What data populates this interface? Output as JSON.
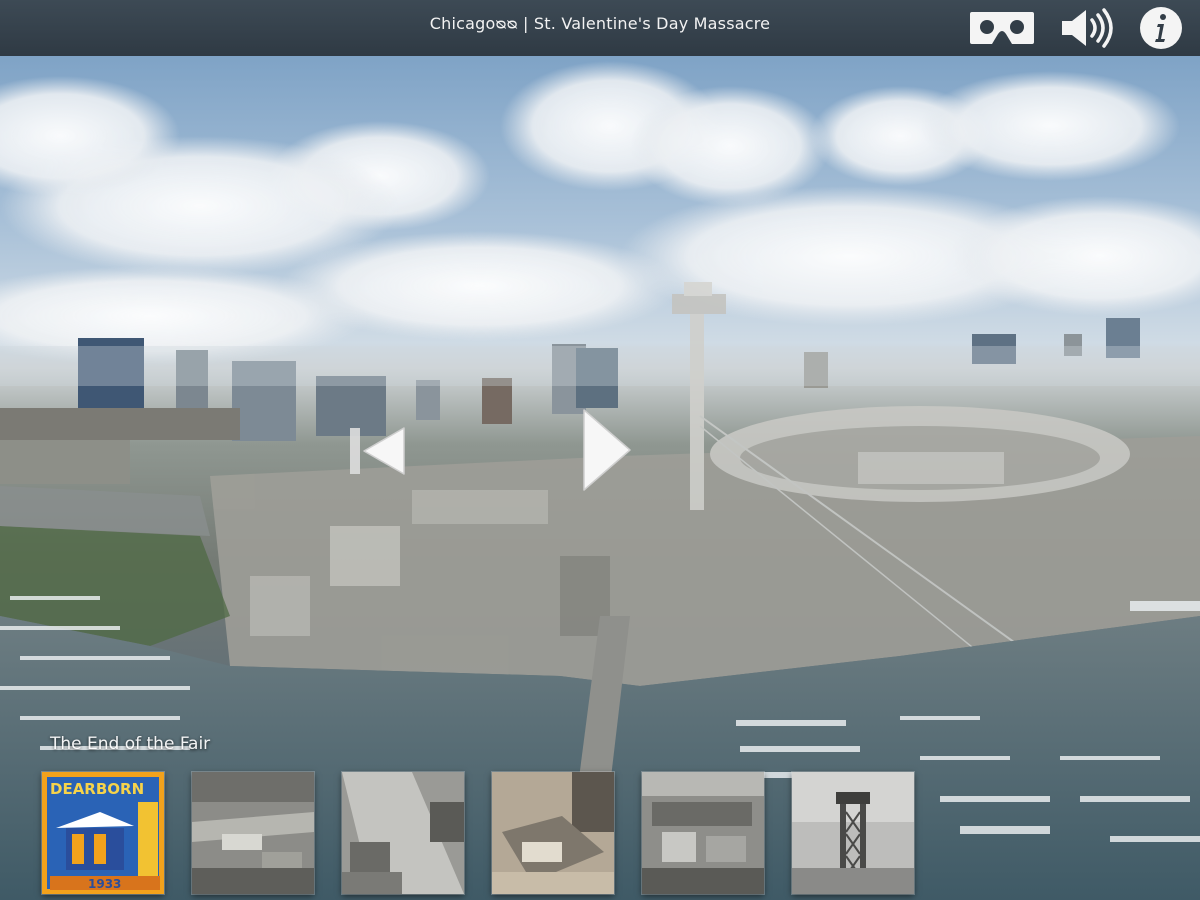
{
  "header": {
    "title": "Chicagoᴓᴓ | St. Valentine's Day Massacre",
    "icons": [
      "vr-headset-icon",
      "speaker-volume-icon",
      "info-icon"
    ]
  },
  "scene": {
    "caption": "The End of the Fair",
    "hotspots": [
      "previous-arrow",
      "next-arrow"
    ]
  },
  "poster": {
    "line1": "DEARBORN",
    "year": "1933"
  },
  "thumbnails": [
    "Dearborn poster",
    "aerial photo",
    "harbor photo",
    "fairground photo",
    "exposition photo",
    "sky ride tower photo"
  ],
  "colors": {
    "topbar": "#2f3a44",
    "poster_blue": "#2a5fb0",
    "poster_orange": "#f2a21c"
  }
}
